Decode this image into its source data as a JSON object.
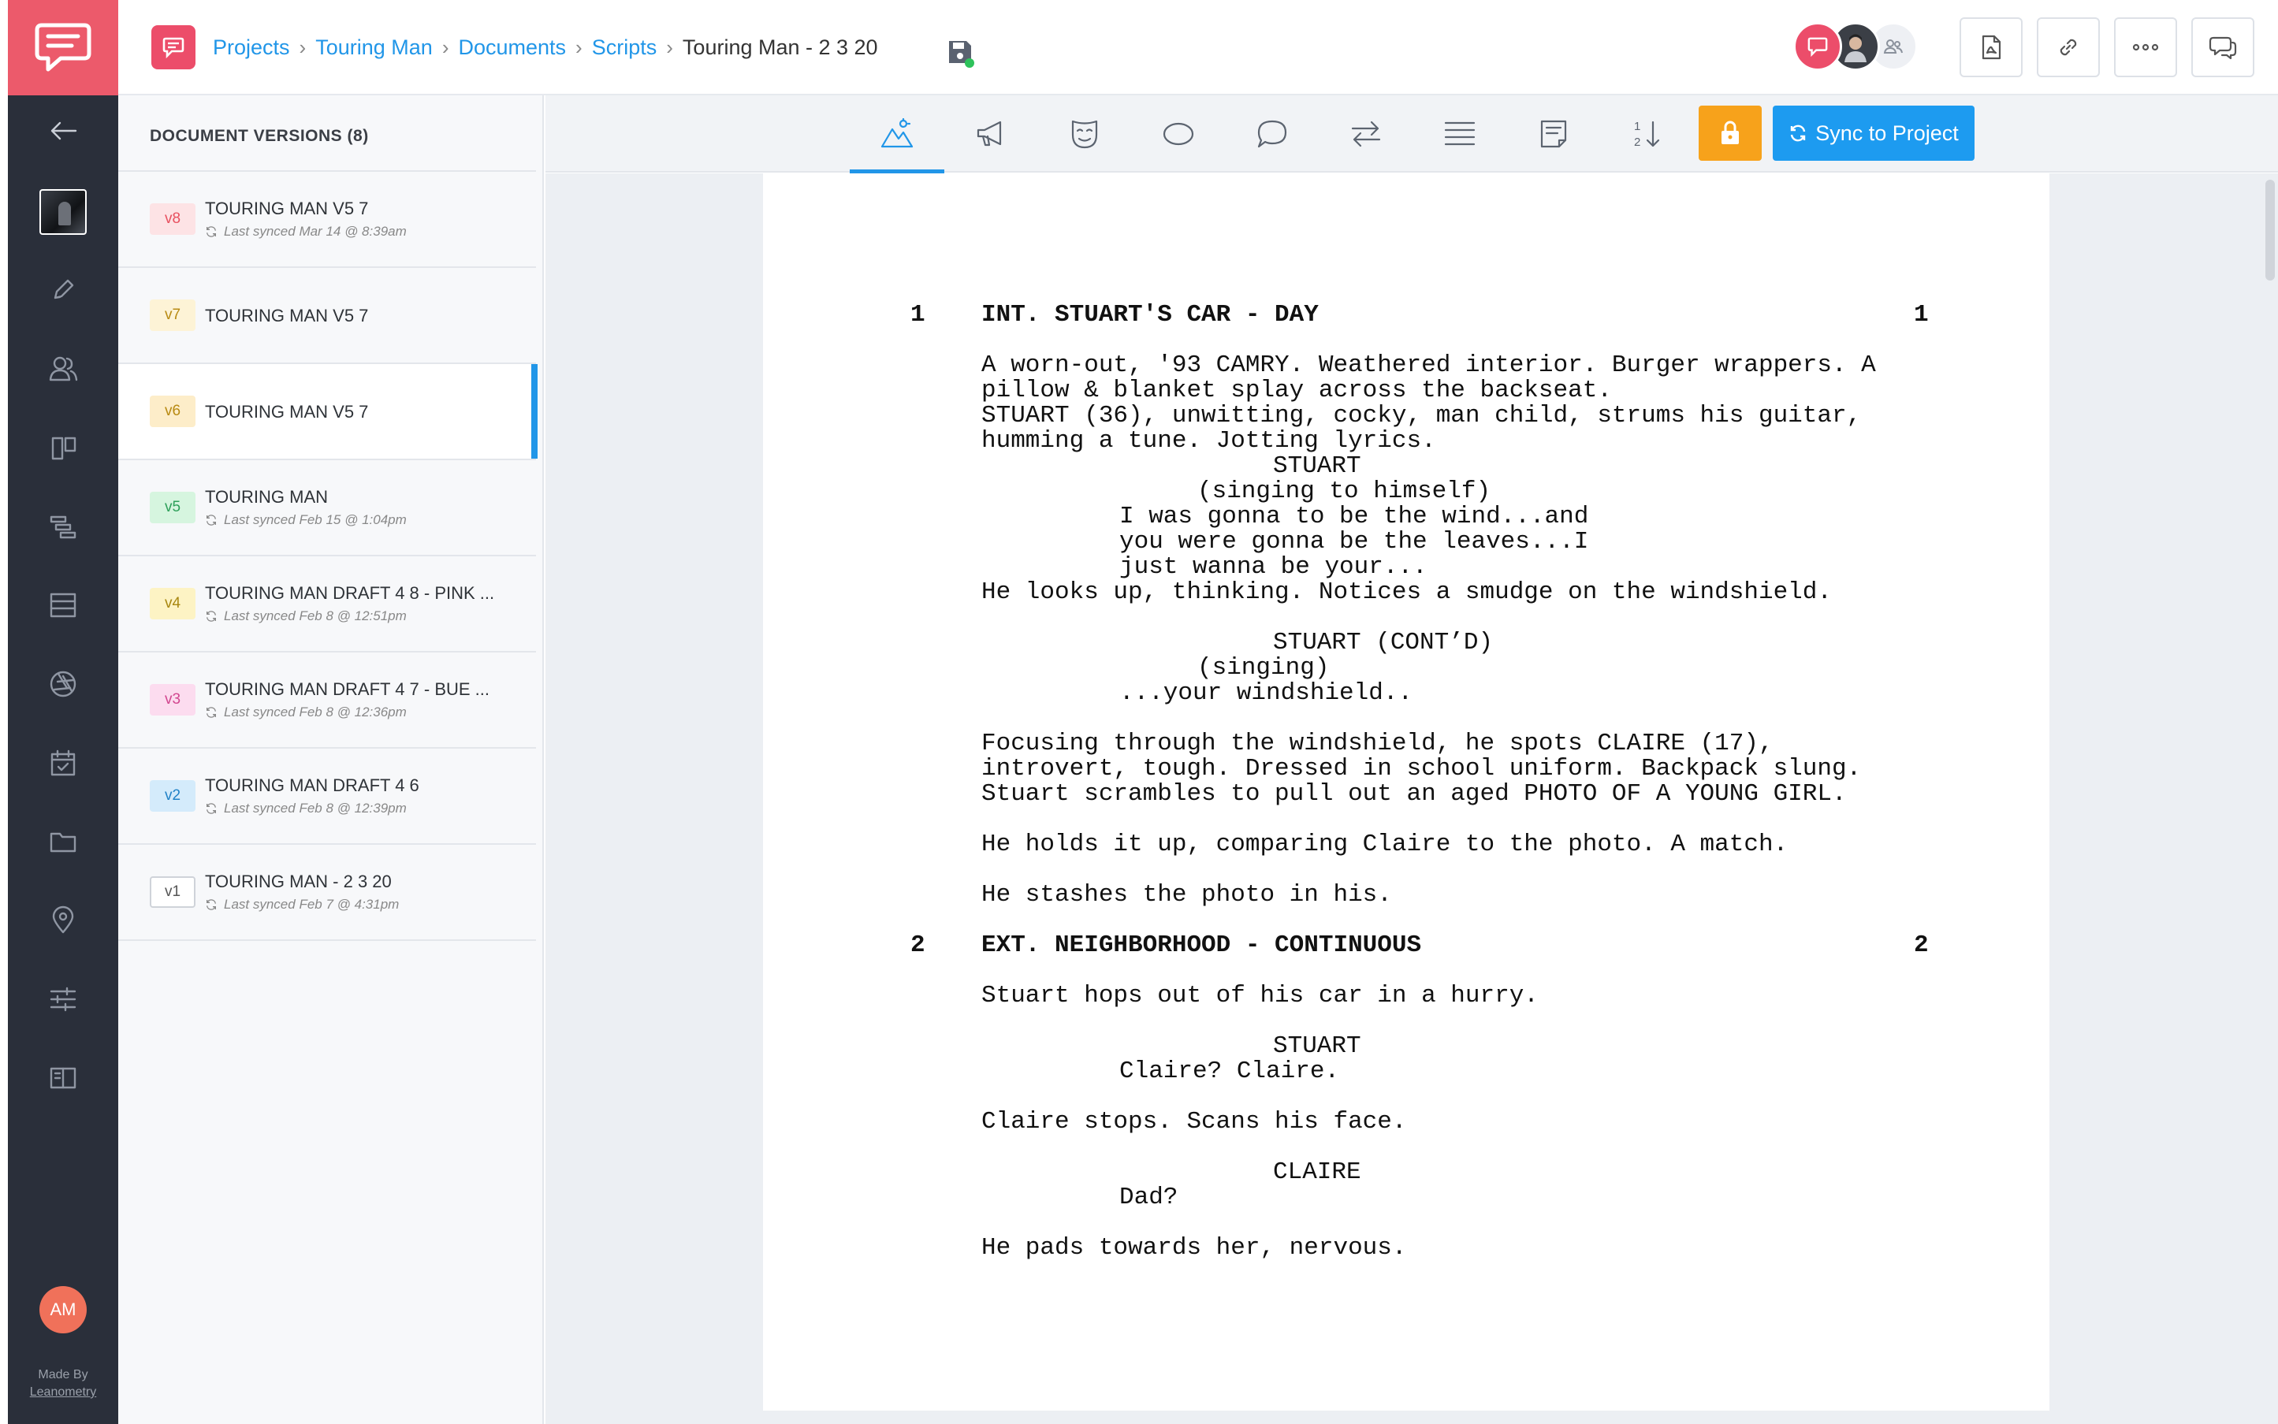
{
  "breadcrumb": [
    "Projects",
    "Touring Man",
    "Documents",
    "Scripts",
    "Touring Man - 2 3 20"
  ],
  "header": {
    "sync_button": "Sync to Project"
  },
  "rail": {
    "avatar_initials": "AM",
    "made_by": "Made By",
    "brand": "Leanometry"
  },
  "versions": {
    "title": "DOCUMENT VERSIONS (8)",
    "items": [
      {
        "badge": "v8",
        "name": "TOURING MAN V5 7",
        "synced": "Last synced Mar 14 @ 8:39am",
        "badge_bg": "#fde3e5",
        "badge_fg": "#e8505f"
      },
      {
        "badge": "v7",
        "name": "TOURING MAN V5 7",
        "synced": "",
        "badge_bg": "#fdf3d6",
        "badge_fg": "#b88a12"
      },
      {
        "badge": "v6",
        "name": "TOURING MAN V5 7",
        "synced": "",
        "badge_bg": "#fdedc9",
        "badge_fg": "#b88a12"
      },
      {
        "badge": "v5",
        "name": "TOURING MAN",
        "synced": "Last synced Feb 15 @ 1:04pm",
        "badge_bg": "#d6f5df",
        "badge_fg": "#2ea05a"
      },
      {
        "badge": "v4",
        "name": "TOURING MAN DRAFT 4 8 - PINK ...",
        "synced": "Last synced Feb 8 @ 12:51pm",
        "badge_bg": "#fdf3c4",
        "badge_fg": "#a88710"
      },
      {
        "badge": "v3",
        "name": "TOURING MAN DRAFT 4 7 - BUE ...",
        "synced": "Last synced Feb 8 @ 12:36pm",
        "badge_bg": "#fcdcef",
        "badge_fg": "#d2468f"
      },
      {
        "badge": "v2",
        "name": "TOURING MAN DRAFT 4 6",
        "synced": "Last synced Feb 8 @ 12:39pm",
        "badge_bg": "#d4ebfb",
        "badge_fg": "#2182c7"
      },
      {
        "badge": "v1",
        "name": "TOURING MAN - 2 3 20",
        "synced": "Last synced Feb 7 @ 4:31pm",
        "badge_bg": "#ffffff",
        "badge_fg": "#555555"
      }
    ],
    "selected": "v6"
  },
  "toolbar": {
    "tools": [
      "scene-icon",
      "megaphone-icon",
      "mask-icon",
      "circle-icon",
      "speech-bubble-icon",
      "swap-arrows-icon",
      "lines-icon",
      "note-icon",
      "sort-icon"
    ],
    "active": "scene-icon"
  },
  "script": {
    "scene1_number": "1",
    "scene1_heading": "INT. STUART'S CAR - DAY",
    "a1": "A worn-out, '93 CAMRY. Weathered interior. Burger wrappers. A\npillow & blanket splay across the backseat.",
    "a2": "STUART (36), unwitting, cocky, man child, strums his guitar,\nhumming a tune. Jotting lyrics.",
    "c1": "STUART",
    "p1": "(singing to himself)",
    "d1": "I was gonna to be the wind...and\nyou were gonna be the leaves...I\njust wanna be your...",
    "a3": "He looks up, thinking. Notices a smudge on the windshield.",
    "c2": "STUART (CONT’D)",
    "p2": "(singing)",
    "d2": "...your windshield..",
    "a4": "Focusing through the windshield, he spots CLAIRE (17),\nintrovert, tough. Dressed in school uniform. Backpack slung.",
    "a5": "Stuart scrambles to pull out an aged PHOTO OF A YOUNG GIRL.",
    "a6": "He holds it up, comparing Claire to the photo. A match.",
    "a7": "He stashes the photo in his.",
    "scene2_number": "2",
    "scene2_heading": "EXT. NEIGHBORHOOD - CONTINUOUS",
    "a8": "Stuart hops out of his car in a hurry.",
    "c3": "STUART",
    "d3": "Claire? Claire.",
    "a9": "Claire stops. Scans his face.",
    "c4": "CLAIRE",
    "d4": "Dad?",
    "a10": "He pads towards her, nervous."
  },
  "colors": {
    "accent": "#2196e8",
    "brand": "#ec5a6b",
    "lock": "#f7a21b",
    "sync": "#1d9bf0",
    "rail": "#2a2f3a"
  }
}
